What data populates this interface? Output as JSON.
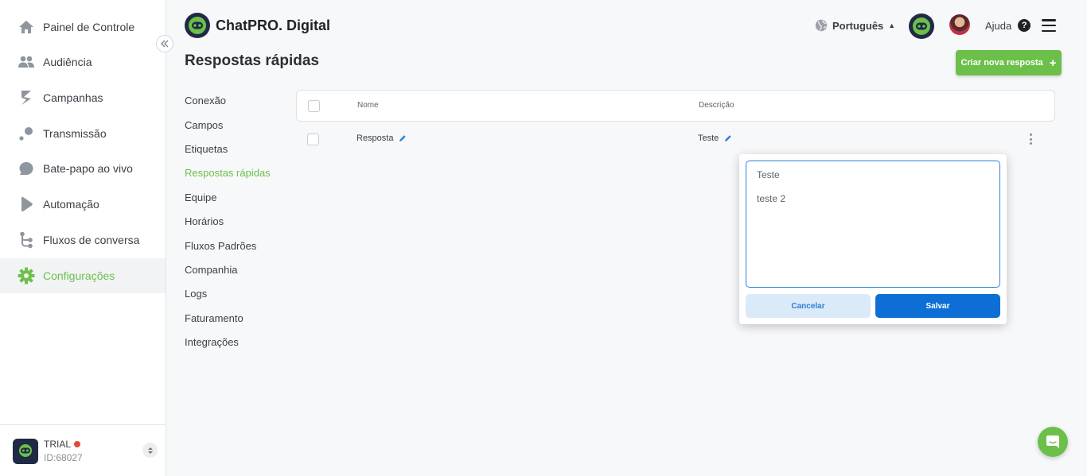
{
  "colors": {
    "accent": "#6cc04a",
    "primary": "#0d6fd6",
    "danger_dot": "#e2493d"
  },
  "sidebar": {
    "items": [
      {
        "label": "Painel de Controle",
        "icon": "home-icon"
      },
      {
        "label": "Audiência",
        "icon": "users-icon"
      },
      {
        "label": "Campanhas",
        "icon": "campaign-icon"
      },
      {
        "label": "Transmissão",
        "icon": "broadcast-icon"
      },
      {
        "label": "Bate-papo ao vivo",
        "icon": "chat-bubble-icon"
      },
      {
        "label": "Automação",
        "icon": "automation-icon"
      },
      {
        "label": "Fluxos de conversa",
        "icon": "flow-icon"
      },
      {
        "label": "Configurações",
        "icon": "gear-icon",
        "active": true
      }
    ],
    "footer": {
      "plan": "TRIAL",
      "account_id": "ID:68027"
    }
  },
  "header": {
    "brand": "ChatPRO. Digital",
    "language": "Português",
    "help_label": "Ajuda"
  },
  "page": {
    "title": "Respostas rápidas",
    "create_button": "Criar nova resposta"
  },
  "settings_menu": [
    "Conexão",
    "Campos",
    "Etiquetas",
    "Respostas rápidas",
    "Equipe",
    "Horários",
    "Fluxos Padrões",
    "Companhia",
    "Logs",
    "Faturamento",
    "Integrações"
  ],
  "settings_active": "Respostas rápidas",
  "table": {
    "columns": {
      "name": "Nome",
      "description": "Descrição"
    },
    "rows": [
      {
        "name": "Resposta",
        "description": "Teste"
      }
    ]
  },
  "editor": {
    "lines": [
      "Teste",
      "teste 2"
    ],
    "cancel_label": "Cancelar",
    "save_label": "Salvar"
  }
}
